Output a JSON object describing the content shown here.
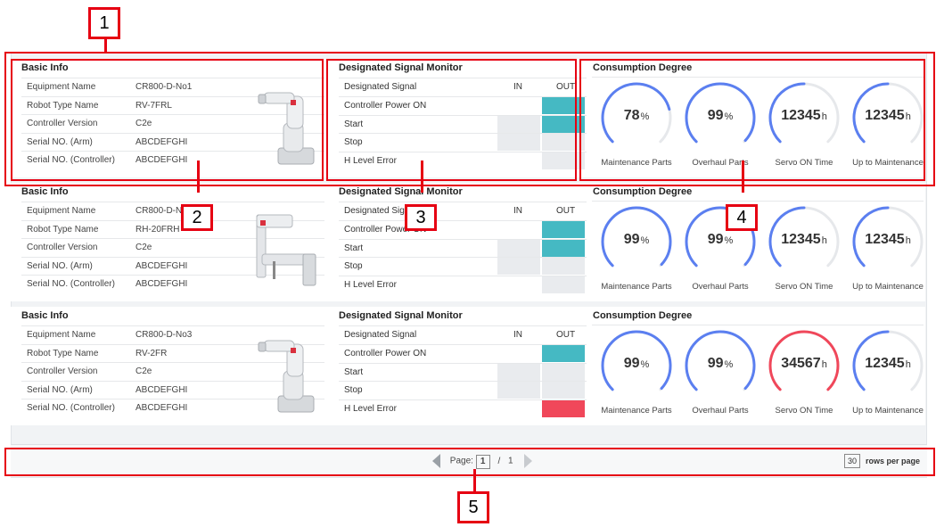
{
  "annotations": [
    "1",
    "2",
    "3",
    "4",
    "5"
  ],
  "labels": {
    "basic_info": "Basic Info",
    "signal_monitor": "Designated Signal Monitor",
    "consumption": "Consumption Degree",
    "equipment_name": "Equipment Name",
    "robot_type": "Robot Type Name",
    "controller_version": "Controller Version",
    "serial_arm": "Serial NO. (Arm)",
    "serial_controller": "Serial NO. (Controller)",
    "designated_signal": "Designated Signal",
    "in": "IN",
    "out": "OUT",
    "sig_power": "Controller Power ON",
    "sig_start": "Start",
    "sig_stop": "Stop",
    "sig_hlevel": "H Level Error",
    "g_maint": "Maintenance Parts",
    "g_overhaul": "Overhaul Parts",
    "g_servo": "Servo ON Time",
    "g_upto": "Up to Maintenance"
  },
  "colors": {
    "on": "#45b9c3",
    "error": "#f0475a",
    "off": "#e9ebee",
    "gauge_blue": "#5b7ff0",
    "gauge_red": "#f0475a",
    "gauge_track": "#e6e8eb",
    "annotation": "#e60012"
  },
  "rows": [
    {
      "equipment_name": "CR800-D-No1",
      "robot_type": "RV-7FRL",
      "controller_version": "C2e",
      "serial_arm": "ABCDEFGHI",
      "serial_controller": "ABCDEFGHI",
      "robot_icon": "articulated-robot-arm",
      "signals": {
        "power_out": "on",
        "start_in": "off",
        "start_out": "on",
        "stop_in": "off",
        "stop_out": "off",
        "hlevel_out": "off"
      },
      "gauges": [
        {
          "value": "78",
          "unit": "%",
          "fraction": 0.78,
          "color": "blue"
        },
        {
          "value": "99",
          "unit": "%",
          "fraction": 0.99,
          "color": "blue"
        },
        {
          "value": "12345",
          "unit": "h",
          "fraction": 0.5,
          "color": "blue"
        },
        {
          "value": "12345",
          "unit": "h",
          "fraction": 0.5,
          "color": "blue"
        }
      ]
    },
    {
      "equipment_name": "CR800-D-N",
      "robot_type": "RH-20FRH",
      "controller_version": "C2e",
      "serial_arm": "ABCDEFGHI",
      "serial_controller": "ABCDEFGHI",
      "robot_icon": "scara-robot",
      "signals": {
        "power_out": "on",
        "start_in": "off",
        "start_out": "on",
        "stop_in": "off",
        "stop_out": "off",
        "hlevel_out": "off"
      },
      "gauges": [
        {
          "value": "99",
          "unit": "%",
          "fraction": 0.99,
          "color": "blue"
        },
        {
          "value": "99",
          "unit": "%",
          "fraction": 0.99,
          "color": "blue"
        },
        {
          "value": "12345",
          "unit": "h",
          "fraction": 0.5,
          "color": "blue"
        },
        {
          "value": "12345",
          "unit": "h",
          "fraction": 0.5,
          "color": "blue"
        }
      ]
    },
    {
      "equipment_name": "CR800-D-No3",
      "robot_type": "RV-2FR",
      "controller_version": "C2e",
      "serial_arm": "ABCDEFGHI",
      "serial_controller": "ABCDEFGHI",
      "robot_icon": "articulated-robot-arm",
      "signals": {
        "power_out": "on",
        "start_in": "off",
        "start_out": "off",
        "stop_in": "off",
        "stop_out": "off",
        "hlevel_out": "error"
      },
      "gauges": [
        {
          "value": "99",
          "unit": "%",
          "fraction": 0.99,
          "color": "blue"
        },
        {
          "value": "99",
          "unit": "%",
          "fraction": 0.99,
          "color": "blue"
        },
        {
          "value": "34567",
          "unit": "h",
          "fraction": 1.0,
          "color": "red"
        },
        {
          "value": "12345",
          "unit": "h",
          "fraction": 0.5,
          "color": "blue"
        }
      ]
    }
  ],
  "pager": {
    "page_label": "Page:",
    "current": "1",
    "separator": "/",
    "total": "1",
    "rows_per_page": "30",
    "rows_per_page_label": "rows per page"
  }
}
